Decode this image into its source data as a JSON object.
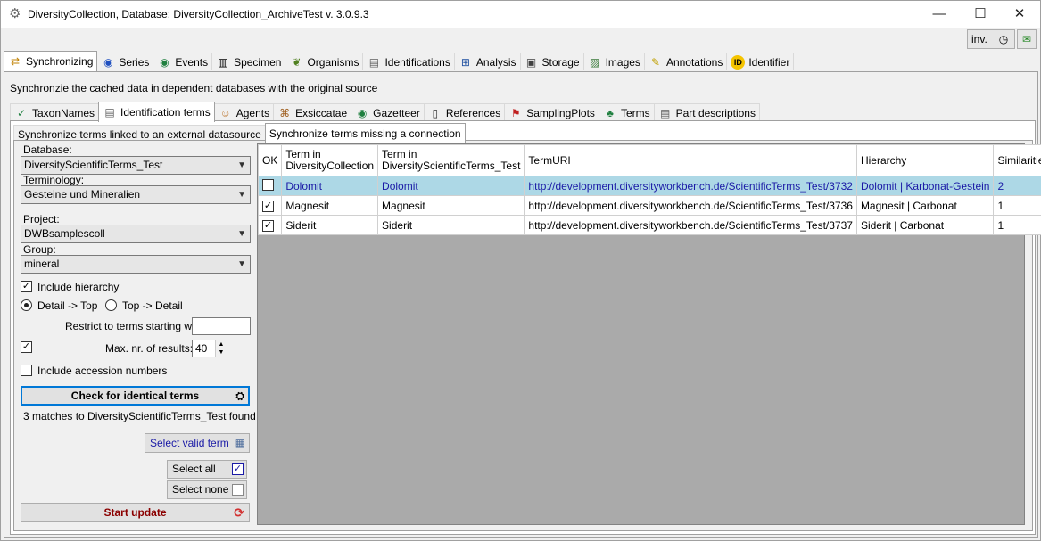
{
  "window": {
    "title": "DiversityCollection,  Database: DiversityCollection_ArchiveTest    v. 3.0.9.3",
    "minimize": "—",
    "maximize": "☐",
    "close": "✕",
    "inv_label": "inv."
  },
  "main_tabs": [
    {
      "label": "Synchronizing",
      "icon": "sync-icon",
      "active": true
    },
    {
      "label": "Series",
      "icon": "globe-series-icon"
    },
    {
      "label": "Events",
      "icon": "globe-events-icon"
    },
    {
      "label": "Specimen",
      "icon": "barcode-icon"
    },
    {
      "label": "Organisms",
      "icon": "leaf-icon"
    },
    {
      "label": "Identifications",
      "icon": "document-icon"
    },
    {
      "label": "Analysis",
      "icon": "analysis-icon"
    },
    {
      "label": "Storage",
      "icon": "storage-icon"
    },
    {
      "label": "Images",
      "icon": "image-icon"
    },
    {
      "label": "Annotations",
      "icon": "annotation-icon"
    },
    {
      "label": "Identifier",
      "icon": "id-icon"
    }
  ],
  "description": "Synchronzie the cached data in dependent databases with the original source",
  "sub_tabs": [
    {
      "label": "TaxonNames",
      "icon": "taxon-icon"
    },
    {
      "label": "Identification terms",
      "icon": "document-icon",
      "active": true
    },
    {
      "label": "Agents",
      "icon": "agent-icon"
    },
    {
      "label": "Exsiccatae",
      "icon": "exsiccatae-icon"
    },
    {
      "label": "Gazetteer",
      "icon": "globe-icon"
    },
    {
      "label": "References",
      "icon": "book-icon"
    },
    {
      "label": "SamplingPlots",
      "icon": "sampling-icon"
    },
    {
      "label": "Terms",
      "icon": "terms-icon"
    },
    {
      "label": "Part descriptions",
      "icon": "document-icon"
    }
  ],
  "inner_tabs": [
    {
      "label": "Synchronize terms linked to an external datasource"
    },
    {
      "label": "Synchronize terms missing a connection",
      "active": true
    }
  ],
  "form": {
    "database_label": "Database:",
    "database_value": "DiversityScientificTerms_Test",
    "terminology_label": "Terminology:",
    "terminology_value": "Gesteine und Mineralien",
    "project_label": "Project:",
    "project_value": "DWBsamplescoll",
    "group_label": "Group:",
    "group_value": "mineral",
    "include_hierarchy": "Include hierarchy",
    "radio_detail_top": "Detail -> Top",
    "radio_top_detail": "Top -> Detail",
    "restrict_label": "Restrict to terms starting with:",
    "restrict_value": "",
    "max_results_label": "Max. nr. of results:",
    "max_results_value": "40",
    "include_accession": "Include accession numbers",
    "check_button": "Check for identical terms",
    "matches_text": "3 matches to DiversityScientificTerms_Test found",
    "select_valid_term": "Select valid term",
    "select_all": "Select all",
    "select_none": "Select none",
    "start_update": "Start update"
  },
  "grid": {
    "headers": [
      "OK",
      "Term in\nDiversityCollection",
      "Term in\nDiversityScientificTerms_Test",
      "TermURI",
      "Hierarchy",
      "Similarities"
    ],
    "rows": [
      {
        "ok": false,
        "term_dc": "Dolomit",
        "term_st": "Dolomit",
        "uri": "http://development.diversityworkbench.de/ScientificTerms_Test/3732",
        "hierarchy": "Dolomit | Karbonat-Gestein",
        "similarities": "2",
        "selected": true
      },
      {
        "ok": true,
        "term_dc": "Magnesit",
        "term_st": "Magnesit",
        "uri": "http://development.diversityworkbench.de/ScientificTerms_Test/3736",
        "hierarchy": "Magnesit | Carbonat",
        "similarities": "1"
      },
      {
        "ok": true,
        "term_dc": "Siderit",
        "term_st": "Siderit",
        "uri": "http://development.diversityworkbench.de/ScientificTerms_Test/3737",
        "hierarchy": "Siderit | Carbonat",
        "similarities": "1"
      }
    ]
  },
  "colors": {
    "selection": "#add8e6",
    "link_text": "#1a1aa6",
    "update_text": "#8b0000"
  }
}
